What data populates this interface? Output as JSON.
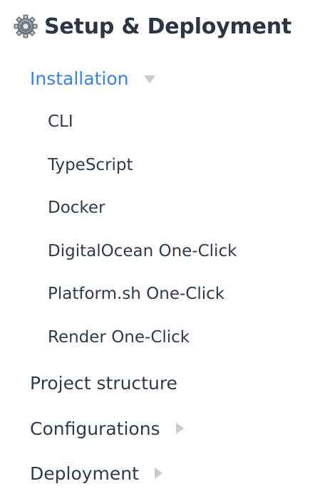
{
  "section": {
    "icon": "gear-icon",
    "title": "Setup & Deployment"
  },
  "nav": {
    "installation": {
      "label": "Installation",
      "expanded": true,
      "children": [
        {
          "label": "CLI"
        },
        {
          "label": "TypeScript"
        },
        {
          "label": "Docker"
        },
        {
          "label": "DigitalOcean One-Click"
        },
        {
          "label": "Platform.sh One-Click"
        },
        {
          "label": "Render One-Click"
        }
      ]
    },
    "project_structure": {
      "label": "Project structure"
    },
    "configurations": {
      "label": "Configurations",
      "expanded": false
    },
    "deployment": {
      "label": "Deployment",
      "expanded": false
    }
  },
  "colors": {
    "active": "#3b82e8",
    "text": "#2f3a4c",
    "caret": "#c8ccd2"
  }
}
